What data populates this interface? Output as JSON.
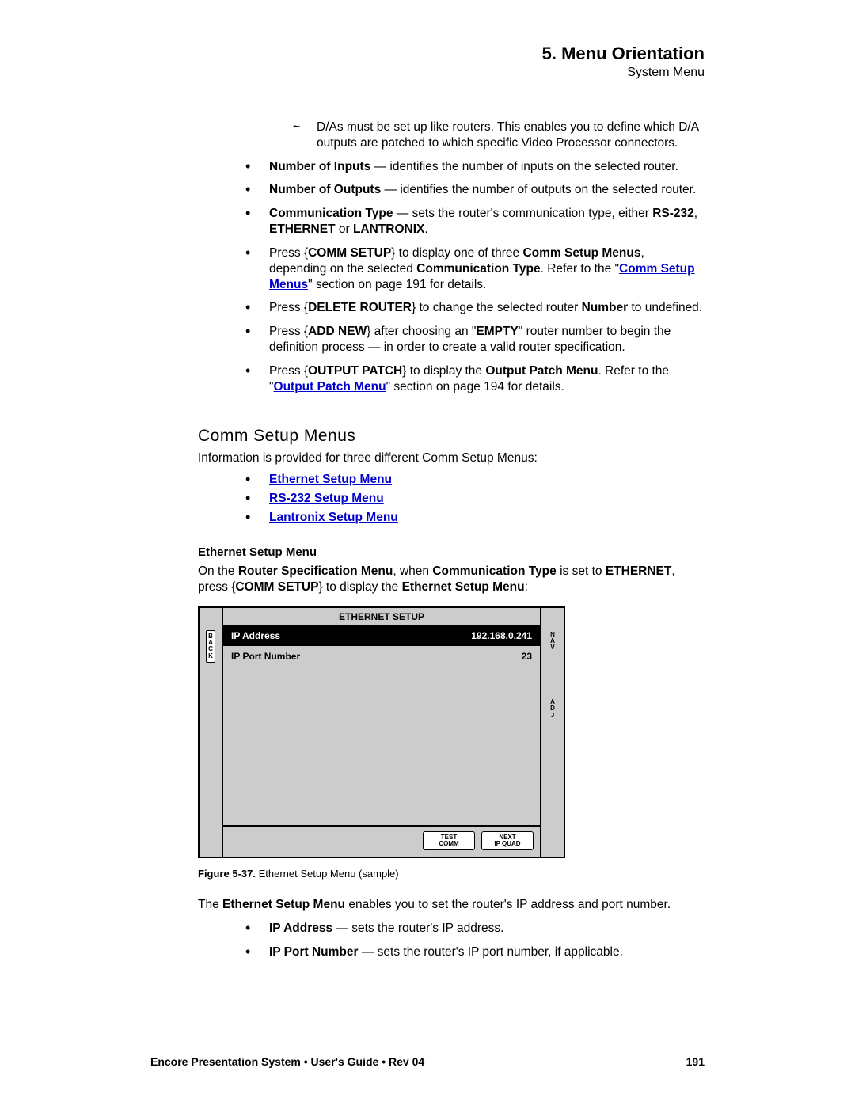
{
  "header": {
    "chapter": "5.  Menu Orientation",
    "subtitle": "System Menu"
  },
  "tilde_para": "D/As must be set up like routers.  This enables you to define which D/A outputs are patched to which specific Video Processor connectors.",
  "bullets": {
    "b1a": "Number of Inputs",
    "b1b": " — identifies the number of inputs on the selected router.",
    "b2a": "Number of Outputs",
    "b2b": " — identifies the number of outputs on the selected router.",
    "b3a": "Communication Type",
    "b3b": " — sets the router's communication type, either ",
    "b3c": "RS-232",
    "b3d": ", ",
    "b3e": "ETHERNET",
    "b3f": " or ",
    "b3g": "LANTRONIX",
    "b3h": ".",
    "b4a": "Press {",
    "b4b": "COMM SETUP",
    "b4c": "} to display one of three ",
    "b4d": "Comm Setup Menus",
    "b4e": ", depending on the selected ",
    "b4f": "Communication Type",
    "b4g": ".  Refer to the \"",
    "b4h": "Comm Setup Menus",
    "b4i": "\" section on page 191 for details.",
    "b5a": "Press {",
    "b5b": "DELETE ROUTER",
    "b5c": "} to change the selected router ",
    "b5d": "Number",
    "b5e": " to undefined.",
    "b6a": "Press {",
    "b6b": "ADD NEW",
    "b6c": "} after choosing an \"",
    "b6d": "EMPTY",
    "b6e": "\" router number to begin the definition process — in order to create a valid router specification.",
    "b7a": "Press {",
    "b7b": "OUTPUT PATCH",
    "b7c": "} to display the ",
    "b7d": "Output Patch Menu",
    "b7e": ".  Refer to the \"",
    "b7f": "Output Patch Menu",
    "b7g": "\" section on page 194 for details."
  },
  "section_heading": "Comm Setup Menus",
  "intro_after_heading": "Information is provided for three different Comm Setup Menus:",
  "links": {
    "l1": "Ethernet Setup Menu",
    "l2": "RS-232 Setup Menu",
    "l3": "Lantronix Setup Menu"
  },
  "ethernet_heading": "Ethernet Setup Menu",
  "ethernet_para": {
    "p1": "On the ",
    "p2": "Router Specification Menu",
    "p3": ", when ",
    "p4": "Communication Type",
    "p5": " is set to ",
    "p6": "ETHERNET",
    "p7": ", press {",
    "p8": "COMM SETUP",
    "p9": "} to display the ",
    "p10": "Ethernet Setup Menu",
    "p11": ":"
  },
  "figure": {
    "back": "BACK",
    "nav": "NAV",
    "adj": "ADJ",
    "title": "ETHERNET SETUP",
    "row1_label": "IP Address",
    "row1_value": "192.168.0.241",
    "row2_label": "IP Port Number",
    "row2_value": "23",
    "btn1": "TEST COMM",
    "btn2": "NEXT IP QUAD"
  },
  "caption": {
    "c1": "Figure 5-37.",
    "c2": "  Ethernet Setup Menu  (sample)"
  },
  "post_figure": {
    "p1": "The ",
    "p2": "Ethernet Setup Menu",
    "p3": " enables you to set the router's IP address and port number."
  },
  "tail_bullets": {
    "t1a": "IP Address",
    "t1b": " — sets the router's IP address.",
    "t2a": "IP Port Number",
    "t2b": " — sets the router's IP port number, if applicable."
  },
  "footer": {
    "left": "Encore Presentation System  •  User's Guide  •  Rev 04",
    "page": "191"
  }
}
